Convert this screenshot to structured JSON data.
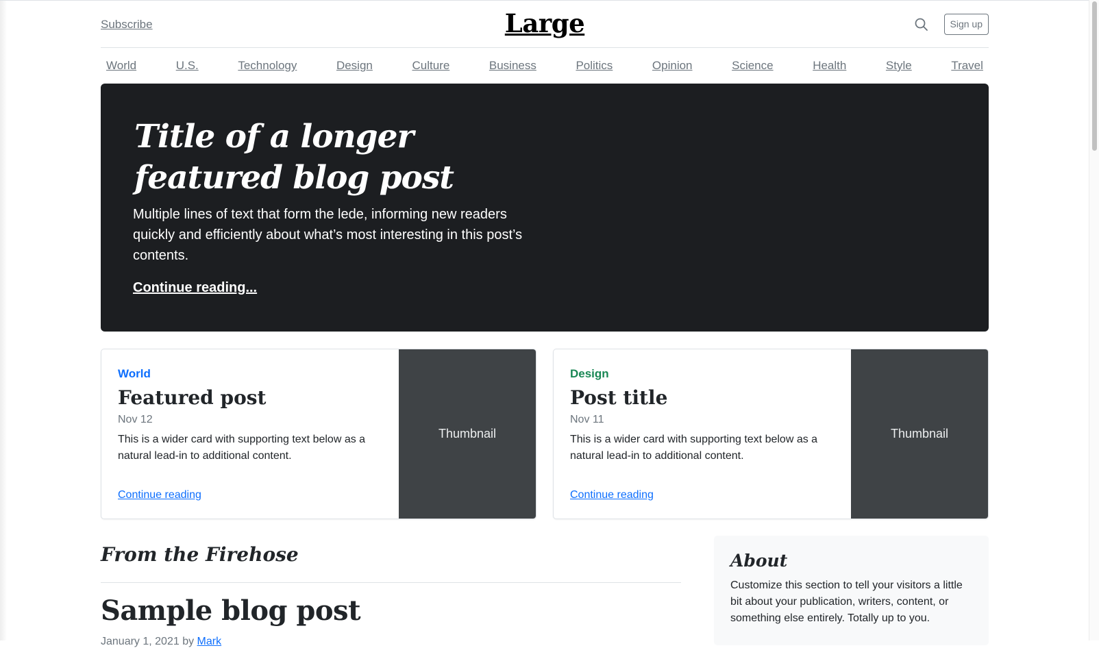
{
  "header": {
    "subscribe_label": "Subscribe",
    "logo_text": "Large",
    "signup_label": "Sign up"
  },
  "nav": {
    "items": [
      "World",
      "U.S.",
      "Technology",
      "Design",
      "Culture",
      "Business",
      "Politics",
      "Opinion",
      "Science",
      "Health",
      "Style",
      "Travel"
    ]
  },
  "hero": {
    "title": "Title of a longer featured blog post",
    "lede": "Multiple lines of text that form the lede, informing new readers quickly and efficiently about what’s most interesting in this post’s contents.",
    "link_label": "Continue reading..."
  },
  "cards": [
    {
      "category": "World",
      "category_color": "#0d6efd",
      "title": "Featured post",
      "date": "Nov 12",
      "text": "This is a wider card with supporting text below as a natural lead-in to additional content.",
      "link_label": "Continue reading",
      "thumbnail_label": "Thumbnail"
    },
    {
      "category": "Design",
      "category_color": "#198754",
      "title": "Post title",
      "date": "Nov 11",
      "text": "This is a wider card with supporting text below as a natural lead-in to additional content.",
      "link_label": "Continue reading",
      "thumbnail_label": "Thumbnail"
    }
  ],
  "main": {
    "section_heading": "From the Firehose",
    "post_title": "Sample blog post",
    "post_date": "January 1, 2021 by",
    "post_author": "Mark"
  },
  "sidebar": {
    "about_title": "About",
    "about_text": "Customize this section to tell your visitors a little bit about your publication, writers, content, or something else entirely. Totally up to you."
  },
  "colors": {
    "hero_background": "#1c1e21",
    "thumbnail_background": "#3f4346",
    "link_blue": "#0d6efd",
    "muted_text": "#6c757d"
  }
}
